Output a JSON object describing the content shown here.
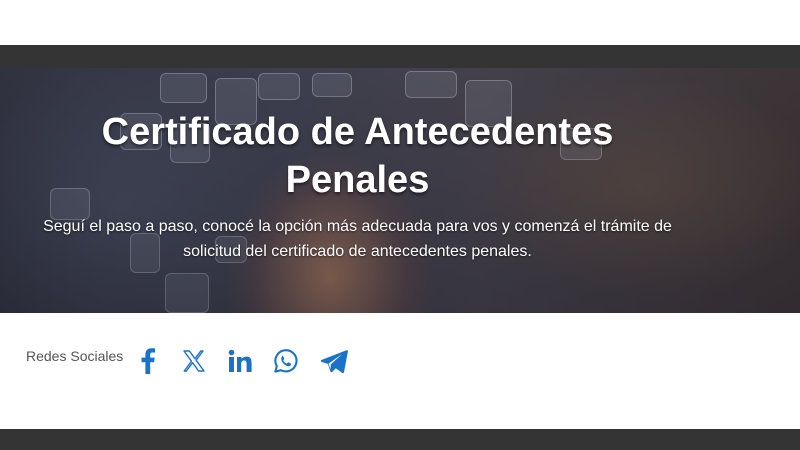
{
  "hero": {
    "title": "Certificado de Antecedentes Penales",
    "subtitle": "Seguí el paso a paso, conocé la opción más adecuada para vos y comenzá el trámite de solicitud del certificado de antecedentes penales."
  },
  "social": {
    "label": "Redes Sociales",
    "icons": [
      "facebook-icon",
      "x-icon",
      "linkedin-icon",
      "whatsapp-icon",
      "telegram-icon"
    ],
    "icon_color": "#1a73c8"
  },
  "colors": {
    "dark_band": "#343434",
    "text_white": "#ffffff"
  }
}
